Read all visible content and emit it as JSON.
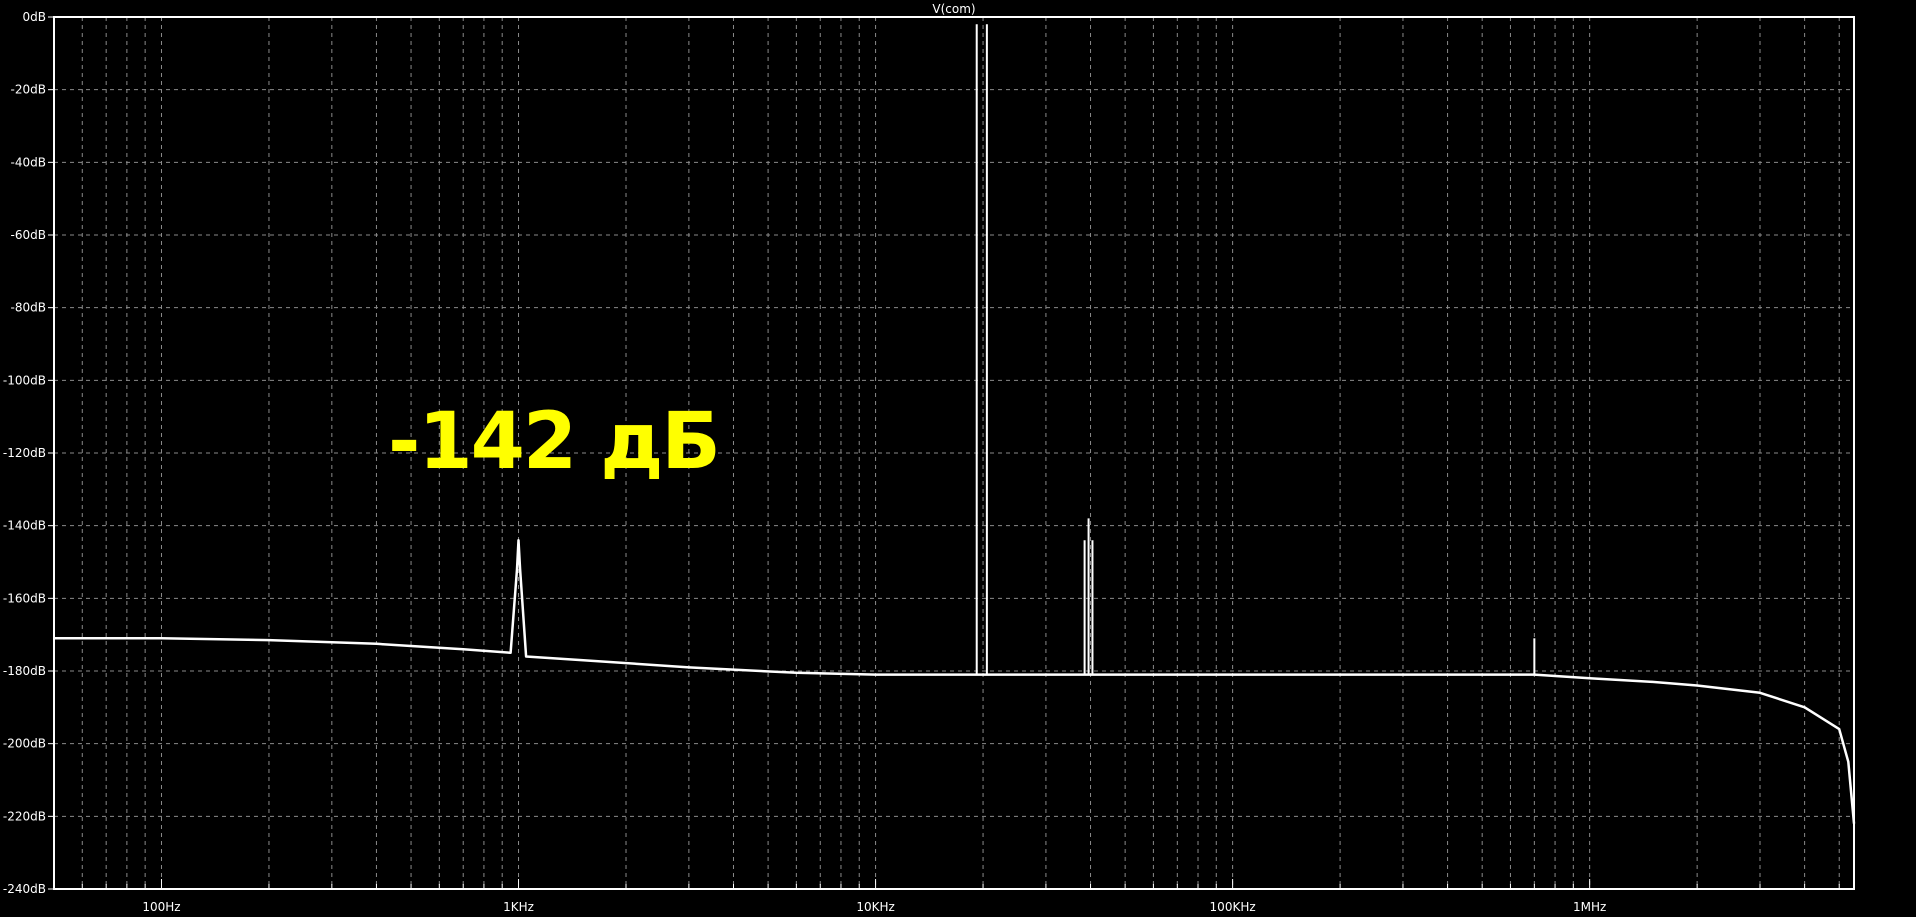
{
  "colors": {
    "background": "#000000",
    "trace": "#ffffff",
    "grid": "#8a8a8a",
    "annotation": "#ffff00"
  },
  "chart_data": {
    "type": "line",
    "title": "V(com)",
    "xlabel": "",
    "ylabel": "",
    "x_scale": "log",
    "xlim": [
      50,
      5500000
    ],
    "ylim": [
      -240,
      0
    ],
    "grid": true,
    "legend": "none",
    "x_tick_labels": [
      "100Hz",
      "1KHz",
      "10KHz",
      "100KHz",
      "1MHz"
    ],
    "x_tick_values": [
      100,
      1000,
      10000,
      100000,
      1000000
    ],
    "y_tick_labels": [
      "0dB",
      "-20dB",
      "-40dB",
      "-60dB",
      "-80dB",
      "-100dB",
      "-120dB",
      "-140dB",
      "-160dB",
      "-180dB",
      "-200dB",
      "-220dB",
      "-240dB"
    ],
    "y_tick_values": [
      0,
      -20,
      -40,
      -60,
      -80,
      -100,
      -120,
      -140,
      -160,
      -180,
      -200,
      -220,
      -240
    ],
    "annotation": {
      "text": "-142 дБ",
      "x": 1000,
      "y": -142
    },
    "series": [
      {
        "x": [
          50,
          100,
          200,
          400,
          700,
          950,
          990,
          1000,
          1010,
          1050,
          1500,
          3000,
          6000,
          10000,
          19000,
          20000,
          21000,
          30000,
          38000,
          40000,
          45000,
          60000,
          100000,
          300000,
          700000,
          1000000,
          1500000,
          2000000,
          3000000,
          4000000,
          5000000,
          5300000,
          5500000
        ],
        "y": [
          -171,
          -171,
          -171.5,
          -172.5,
          -174,
          -175,
          -152,
          -144,
          -152,
          -176,
          -177,
          -179,
          -180.5,
          -181,
          -181,
          -181,
          -181,
          -181,
          -181,
          -181,
          -181,
          -181,
          -181,
          -181,
          -181,
          -182,
          -183,
          -184,
          -186,
          -190,
          -196,
          -205,
          -222
        ]
      }
    ],
    "spikes": [
      {
        "x": 19200,
        "y": -2
      },
      {
        "x": 20500,
        "y": -2
      },
      {
        "x": 38500,
        "y": -144
      },
      {
        "x": 39500,
        "y": -138
      },
      {
        "x": 40500,
        "y": -144
      },
      {
        "x": 700000,
        "y": -171
      }
    ]
  }
}
